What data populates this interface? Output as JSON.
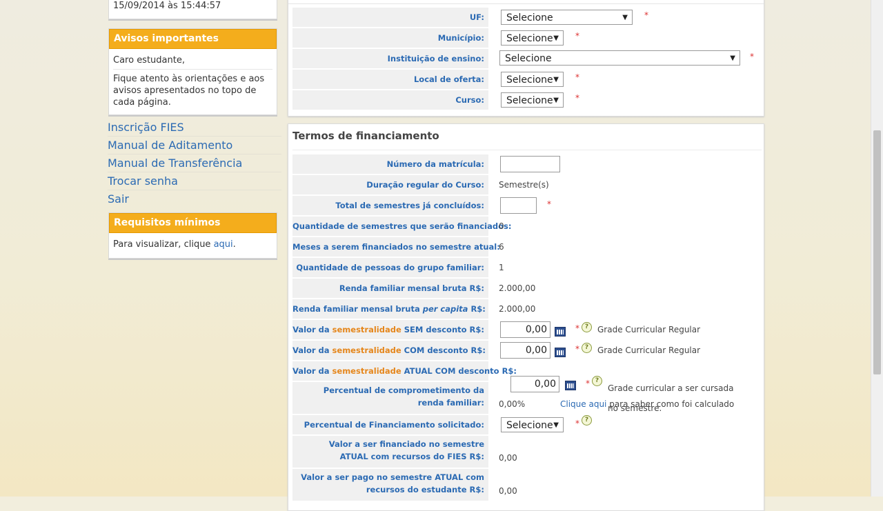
{
  "timestamp": "15/09/2014 às 15:44:57",
  "avisos": {
    "title": "Avisos importantes",
    "line1": "Caro estudante,",
    "line2": "Fique atento às orientações e aos avisos apresentados no topo de cada página."
  },
  "menu": [
    "Inscrição FIES",
    "Manual de Aditamento",
    "Manual de Transferência",
    "Trocar senha",
    "Sair"
  ],
  "requisitos": {
    "title": "Requisitos mínimos",
    "text_before": "Para visualizar, clique ",
    "link": "aqui",
    "text_after": "."
  },
  "top_form": {
    "uf_label": "UF:",
    "municipio_label": "Município:",
    "instituicao_label": "Instituição de ensino:",
    "local_label": "Local de oferta:",
    "curso_label": "Curso:",
    "select_value": "Selecione",
    "required": "*"
  },
  "termos": {
    "title": "Termos de financiamento",
    "numero_matricula_label": "Número da matrícula:",
    "duracao_label": "Duração regular do Curso:",
    "duracao_value": "Semestre(s)",
    "total_semestres_label": "Total de semestres já concluídos:",
    "qtd_semestres_label": "Quantidade de semestres que serão financiados:",
    "qtd_semestres_value": "0",
    "meses_label": "Meses a serem financiados no semestre atual:",
    "meses_value": "6",
    "pessoas_label": "Quantidade de pessoas do grupo familiar:",
    "pessoas_value": "1",
    "renda_label": "Renda familiar mensal bruta R$:",
    "renda_value": "2.000,00",
    "renda_pc_label_a": "Renda familiar mensal bruta ",
    "renda_pc_label_b": "per capita",
    "renda_pc_label_c": " R$:",
    "renda_pc_value": "2.000,00",
    "sem_label_a": "Valor da ",
    "semestralidade": "semestralidade",
    "sem_label_b": " SEM desconto R$:",
    "com_label_b": " COM desconto R$:",
    "atual_label_b": " ATUAL COM desconto R$:",
    "money_zero": "0,00",
    "grade_regular": "Grade Curricular Regular",
    "grade_cursada": "Grade curricular a ser cursada no semestre.",
    "percentual_label": "Percentual de comprometimento da renda familiar:",
    "percentual_value": "0,00%",
    "clique_aqui": "Clique aqui",
    "clique_rest": " para saber como foi calculado",
    "financiamento_label": "Percentual de Financiamento solicitado:",
    "valor_fies_label": "Valor a ser financiado no semestre ATUAL com recursos do FIES R$:",
    "valor_fies_value": "0,00",
    "valor_estudante_label": "Valor a ser pago no semestre ATUAL com recursos do estudante R$:",
    "valor_estudante_value": "0,00",
    "help": "?"
  }
}
